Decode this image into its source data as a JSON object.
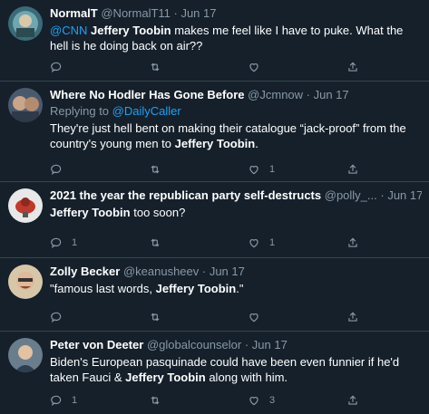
{
  "tweets": [
    {
      "name": "NormalT",
      "handle": "@NormalT11",
      "sep": " · ",
      "date": "Jun 17",
      "reply_prefix": "",
      "reply_to": "",
      "body": [
        {
          "t": "link",
          "v": "@CNN"
        },
        {
          "t": "text",
          "v": " "
        },
        {
          "t": "bold",
          "v": "Jeffery Toobin"
        },
        {
          "t": "text",
          "v": " makes me feel like I have to puke. What the hell is he doing back on air??"
        }
      ],
      "counts": {
        "reply": "",
        "retweet": "",
        "like": ""
      }
    },
    {
      "name": "Where No Hodler Has Gone Before",
      "handle": "@Jcmnow",
      "sep": " · ",
      "date": "Jun 17",
      "reply_prefix": "Replying to ",
      "reply_to": "@DailyCaller",
      "body": [
        {
          "t": "text",
          "v": "They're just hell bent on making their catalogue “jack-proof” from the country's young men to "
        },
        {
          "t": "bold",
          "v": "Jeffery Toobin"
        },
        {
          "t": "text",
          "v": "."
        }
      ],
      "counts": {
        "reply": "",
        "retweet": "",
        "like": "1"
      }
    },
    {
      "name": "2021 the year the republican party self-destructs",
      "handle": "@polly_...",
      "sep": " · ",
      "date": "Jun 17",
      "reply_prefix": "",
      "reply_to": "",
      "body": [
        {
          "t": "bold",
          "v": "Jeffery Toobin"
        },
        {
          "t": "text",
          "v": " too soon?"
        }
      ],
      "counts": {
        "reply": "1",
        "retweet": "",
        "like": "1"
      }
    },
    {
      "name": "Zolly Becker",
      "handle": "@keanusheev",
      "sep": " · ",
      "date": "Jun 17",
      "reply_prefix": "",
      "reply_to": "",
      "body": [
        {
          "t": "text",
          "v": "\"famous last words, "
        },
        {
          "t": "bold",
          "v": "Jeffery Toobin"
        },
        {
          "t": "text",
          "v": ".\""
        }
      ],
      "counts": {
        "reply": "",
        "retweet": "",
        "like": ""
      }
    },
    {
      "name": "Peter von Deeter",
      "handle": "@globalcounselor",
      "sep": " · ",
      "date": "Jun 17",
      "reply_prefix": "",
      "reply_to": "",
      "body": [
        {
          "t": "text",
          "v": "Biden's European pasquinade could have been even funnier if he'd taken Fauci & "
        },
        {
          "t": "bold",
          "v": "Jeffery Toobin"
        },
        {
          "t": "text",
          "v": " along with him."
        }
      ],
      "counts": {
        "reply": "1",
        "retweet": "",
        "like": "3"
      }
    }
  ],
  "icons": {
    "reply": "reply-icon",
    "retweet": "retweet-icon",
    "like": "like-icon",
    "share": "share-icon"
  },
  "colors": {
    "background": "#15202b",
    "text": "#ffffff",
    "muted": "#8899a6",
    "link": "#1da1f2",
    "divider": "#38444d"
  }
}
